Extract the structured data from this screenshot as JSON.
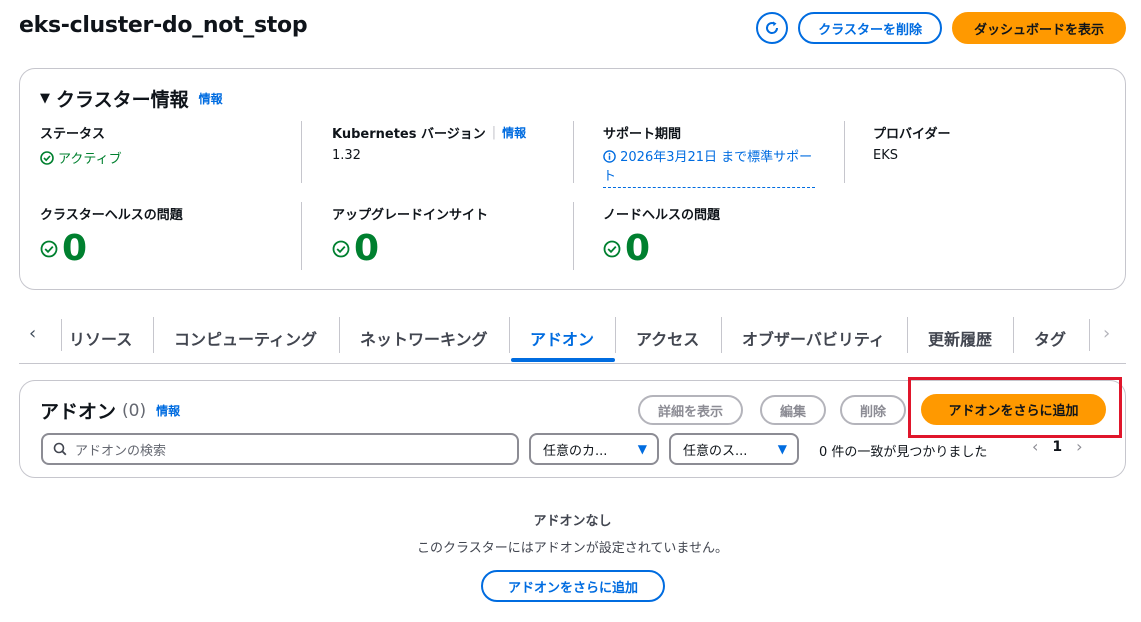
{
  "page": {
    "title": "eks-cluster-do_not_stop",
    "actions": {
      "delete_label": "クラスターを削除",
      "dashboard_label": "ダッシュボードを表示"
    }
  },
  "cluster_info": {
    "title": "クラスター情報",
    "info_link": "情報",
    "status": {
      "label": "ステータス",
      "value": "アクティブ"
    },
    "k8s": {
      "label": "Kubernetes バージョン",
      "info_link": "情報",
      "value": "1.32"
    },
    "support": {
      "label": "サポート期間",
      "value": "2026年3月21日 まで標準サポート"
    },
    "provider": {
      "label": "プロバイダー",
      "value": "EKS"
    },
    "health": {
      "label": "クラスターヘルスの問題",
      "value": "0"
    },
    "upgrade": {
      "label": "アップグレードインサイト",
      "value": "0"
    },
    "node_health": {
      "label": "ノードヘルスの問題",
      "value": "0"
    }
  },
  "tabs": {
    "items": [
      "リソース",
      "コンピューティング",
      "ネットワーキング",
      "アドオン",
      "アクセス",
      "オブザーバビリティ",
      "更新履歴",
      "タグ"
    ],
    "active": "アドオン"
  },
  "addons": {
    "title": "アドオン",
    "count": "(0)",
    "info_link": "情報",
    "view_details_label": "詳細を表示",
    "edit_label": "編集",
    "delete_label": "削除",
    "add_more_label": "アドオンをさらに追加",
    "search_placeholder": "アドオンの検索",
    "filter_category": "任意のカ...",
    "filter_status": "任意のス...",
    "result_text": "0 件の一致が見つかりました",
    "page_number": "1"
  },
  "empty_state": {
    "title": "アドオンなし",
    "description": "このクラスターにはアドオンが設定されていません。",
    "button_label": "アドオンをさらに追加"
  },
  "colors": {
    "accent": "#006ce0",
    "primary_button": "#ff9900",
    "success": "#00802f",
    "highlight_box": "#e0162b"
  }
}
